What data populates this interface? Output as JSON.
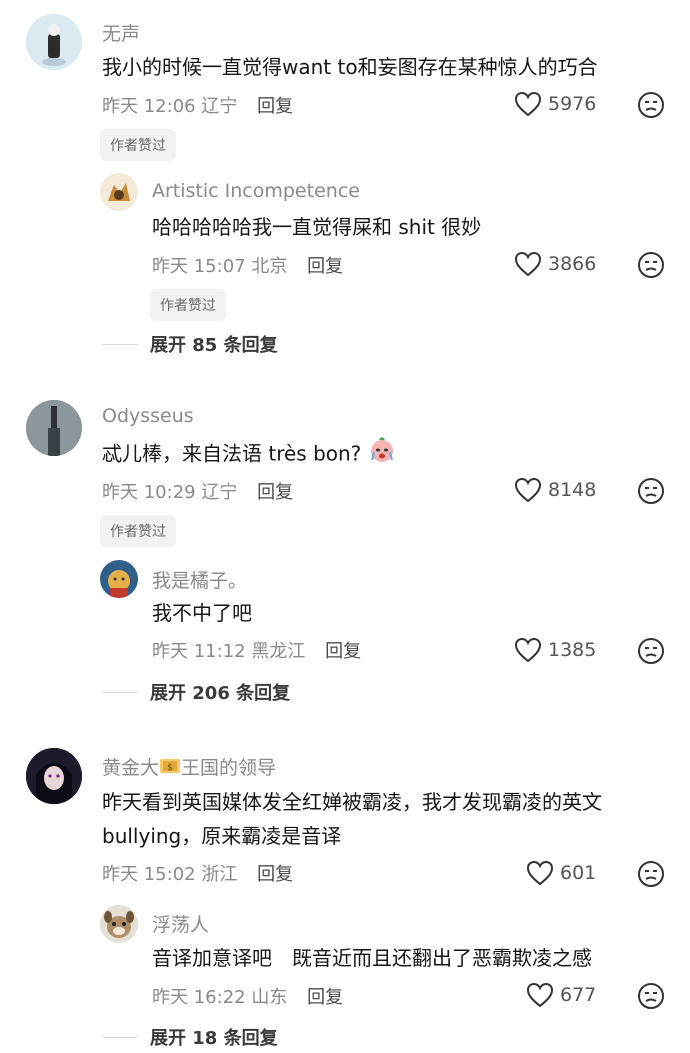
{
  "comments": [
    {
      "username": "无声",
      "text": "我小的时候一直觉得want to和妄图存在某种惊人的巧合",
      "date": "昨天 12:06",
      "location": "辽宁",
      "reply_label": "回复",
      "likes": "5976",
      "badge": "作者赞过",
      "replies": [
        {
          "username": "Artistic Incompetence",
          "text": "哈哈哈哈哈我一直觉得屎和 shit 很妙",
          "date": "昨天 15:07",
          "location": "北京",
          "reply_label": "回复",
          "likes": "3866",
          "badge": "作者赞过"
        }
      ],
      "expand_label": "展开 85 条回复"
    },
    {
      "username": "Odysseus",
      "text": "忒儿棒，来自法语 très bon?",
      "date": "昨天 10:29",
      "location": "辽宁",
      "reply_label": "回复",
      "likes": "8148",
      "badge": "作者赞过",
      "replies": [
        {
          "username": "我是橘子。",
          "text": "我不中了吧",
          "date": "昨天 11:12",
          "location": "黑龙江",
          "reply_label": "回复",
          "likes": "1385"
        }
      ],
      "expand_label": "展开 206 条回复"
    },
    {
      "username_a": "黄金大",
      "username_b": "王国的领导",
      "text": "昨天看到英国媒体发全红婵被霸凌，我才发现霸凌的英文 bullying，原来霸凌是音译",
      "date": "昨天 15:02",
      "location": "浙江",
      "reply_label": "回复",
      "likes": "601",
      "replies": [
        {
          "username": "浮荡人",
          "text": "音译加意译吧　既音近而且还翻出了恶霸欺凌之感",
          "date": "昨天 16:22",
          "location": "山东",
          "reply_label": "回复",
          "likes": "677"
        }
      ],
      "expand_label": "展开 18 条回复"
    }
  ],
  "icons": {
    "like": "heart-outline-icon",
    "dislike": "frown-face-icon",
    "emoji": "crying-face-emoji",
    "money": "money-bag-emoji"
  },
  "colors": {
    "username": "#8a8a8a",
    "text": "#161616",
    "badge_bg": "#f2f2f2"
  }
}
